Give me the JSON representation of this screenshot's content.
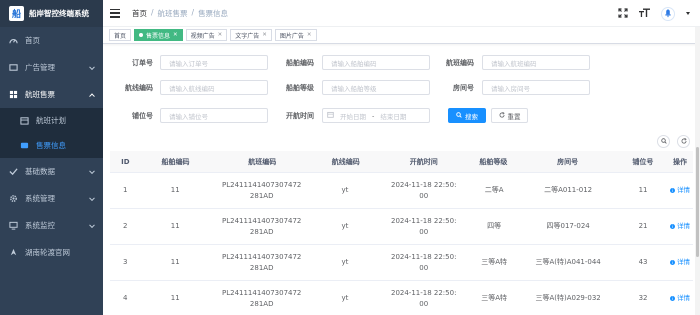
{
  "brand": {
    "title": "船岸智控终端系统",
    "logo_glyph": "船"
  },
  "sidebar": {
    "items": [
      {
        "label": "首页",
        "icon": "dashboard-icon"
      },
      {
        "label": "广告管理",
        "icon": "ad-icon",
        "expandable": true
      },
      {
        "label": "航班售票",
        "icon": "ticket-icon",
        "expandable": true,
        "open": true
      },
      {
        "label": "航班计划",
        "icon": "calendar-icon",
        "sub": true
      },
      {
        "label": "售票信息",
        "icon": "ticket-info-icon",
        "sub": true,
        "active": true
      },
      {
        "label": "基础数据",
        "icon": "database-icon",
        "expandable": true
      },
      {
        "label": "系统管理",
        "icon": "gear-icon",
        "expandable": true
      },
      {
        "label": "系统监控",
        "icon": "monitor-icon",
        "expandable": true
      },
      {
        "label": "湖南轮渡官网",
        "icon": "compass-icon"
      }
    ]
  },
  "header": {
    "breadcrumb": [
      "首页",
      "/",
      "航班售票",
      "/",
      "售票信息"
    ]
  },
  "tags": [
    {
      "label": "首页",
      "closable": false,
      "active": false
    },
    {
      "label": "售票信息",
      "closable": true,
      "active": true
    },
    {
      "label": "视频广告",
      "closable": true,
      "active": false
    },
    {
      "label": "文字广告",
      "closable": true,
      "active": false
    },
    {
      "label": "图片广告",
      "closable": true,
      "active": false
    }
  ],
  "form": {
    "order_no": {
      "label": "订单号",
      "placeholder": "请输入订单号"
    },
    "ship_code": {
      "label": "船舶编码",
      "placeholder": "请输入船舶编码"
    },
    "route_code": {
      "label": "航班编码",
      "placeholder": "请输入航班编码"
    },
    "line_code": {
      "label": "航线编码",
      "placeholder": "请输入航线编码"
    },
    "ship_class": {
      "label": "船舶等级",
      "placeholder": "请输入船舶等级"
    },
    "room_no": {
      "label": "房间号",
      "placeholder": "请输入房间号"
    },
    "berth_no": {
      "label": "铺位号",
      "placeholder": "请输入铺位号"
    },
    "depart_time": {
      "label": "开航时间",
      "start_placeholder": "开始日期",
      "separator": "-",
      "end_placeholder": "结束日期"
    },
    "search_label": "搜索",
    "reset_label": "重置"
  },
  "table": {
    "columns": [
      "ID",
      "船舶编码",
      "航班编码",
      "航线编码",
      "开航时间",
      "船舶等级",
      "房间号",
      "铺位号",
      "操作"
    ],
    "action_label": "详情",
    "rows": [
      {
        "id": "1",
        "ship": "11",
        "flight": "PL2411141407307472281AD",
        "line": "yt",
        "time": "2024-11-18 22:50:00",
        "grade": "二等A",
        "room": "二等A011-012",
        "berth": "11"
      },
      {
        "id": "2",
        "ship": "11",
        "flight": "PL2411141407307472281AD",
        "line": "yt",
        "time": "2024-11-18 22:50:00",
        "grade": "四等",
        "room": "四等017-024",
        "berth": "21"
      },
      {
        "id": "3",
        "ship": "11",
        "flight": "PL2411141407307472281AD",
        "line": "yt",
        "time": "2024-11-18 22:50:00",
        "grade": "三等A特",
        "room": "三等A(特)A041-044",
        "berth": "43"
      },
      {
        "id": "4",
        "ship": "11",
        "flight": "PL2411141407307472281AD",
        "line": "yt",
        "time": "2024-11-18 22:50:00",
        "grade": "三等A特",
        "room": "三等A(特)A029-032",
        "berth": "32"
      }
    ]
  },
  "colors": {
    "sidebar_bg": "#304156",
    "active": "#409eff",
    "primary": "#1890ff",
    "tag_active": "#42b983"
  }
}
